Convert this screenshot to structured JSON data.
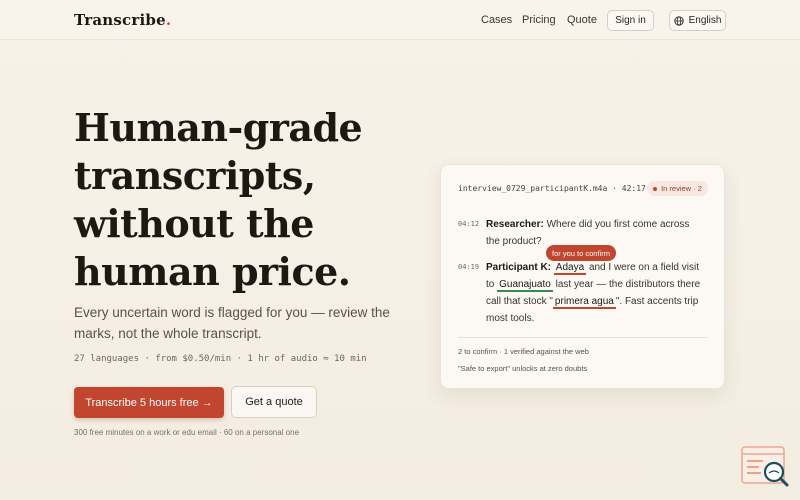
{
  "nav": {
    "logo": "Transcribe",
    "logo_dot": ".",
    "links": [
      "Cases",
      "Pricing",
      "Quote"
    ],
    "sign_in": "Sign in",
    "language": "English"
  },
  "hero": {
    "title_lines": [
      "Human-grade",
      "transcripts,",
      "without the",
      "human price."
    ],
    "subtitle": "Every uncertain word is flagged for you — review the marks, not the whole transcript.",
    "meta": "27 languages · from $0.50/min · 1 hr of audio ≈ 10 min",
    "cta_primary": "Transcribe 5 hours free →",
    "cta_secondary": "Get a quote",
    "footnote": "300 free minutes on a work or edu email · 60 on a personal one"
  },
  "card": {
    "file": "interview_0729_participantK.m4a · 42:17",
    "badge": "In review · 2",
    "tooltip": "for you to confirm",
    "entries": [
      {
        "ts": "04:12",
        "speaker": "Researcher:",
        "line1": "Where did you first come across",
        "line2": "the product?"
      },
      {
        "ts": "04:19",
        "speaker": "Participant K:",
        "flag1": "Adaya",
        "t1": "and I were on a field visit",
        "t2": "to",
        "flag2": "Guanajuato",
        "t3": "last year — the distributors there",
        "t4": "call that stock \"",
        "flag3": "primera agua",
        "t5": "\". Fast accents trip",
        "t6": "most tools."
      }
    ],
    "foot1": "2 to confirm · 1 verified against the web",
    "foot2": "\"Safe to export\" unlocks at zero doubts"
  },
  "colors": {
    "accent": "#c2452f",
    "verified": "#3a8a55",
    "background": "#f7f1e8"
  },
  "icons": {
    "language": "globe-icon",
    "assistant": "search-transcript-icon"
  }
}
